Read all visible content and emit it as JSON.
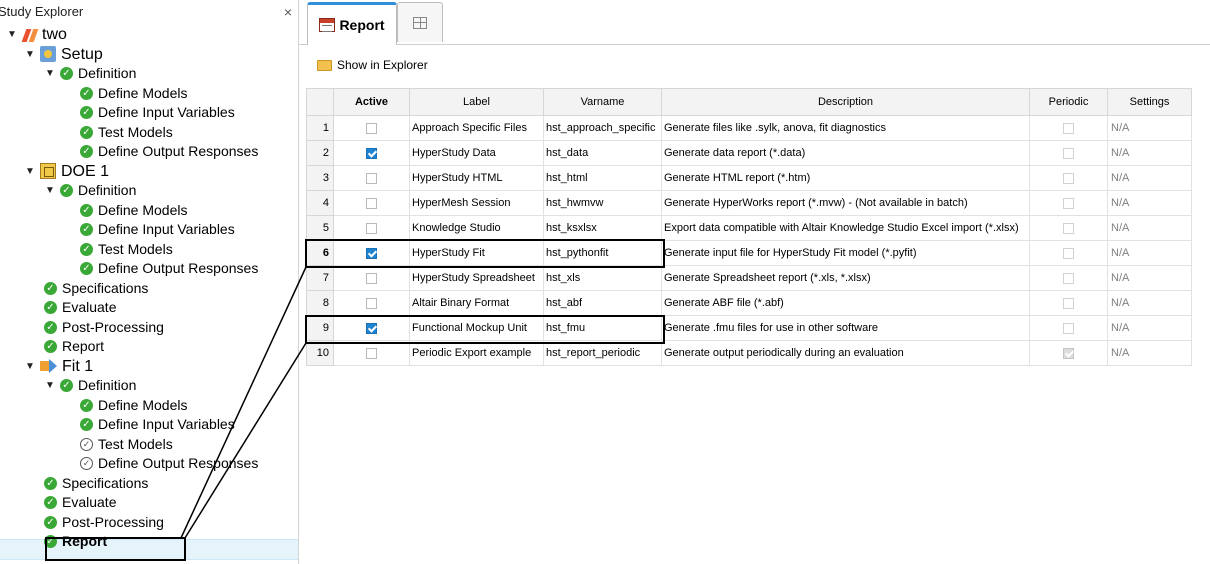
{
  "explorer": {
    "title": "Study Explorer",
    "close": "×",
    "tree": [
      {
        "label": "two",
        "icon": "study-icon",
        "level": 0,
        "kind": "top"
      },
      {
        "label": "Setup",
        "icon": "setup-icon",
        "level": 1,
        "kind": "top"
      },
      {
        "label": "Definition",
        "icon": "check-icon",
        "level": 2
      },
      {
        "label": "Define Models",
        "icon": "check-icon",
        "level": 3
      },
      {
        "label": "Define Input Variables",
        "icon": "check-icon",
        "level": 3
      },
      {
        "label": "Test Models",
        "icon": "check-icon",
        "level": 3
      },
      {
        "label": "Define Output Responses",
        "icon": "check-icon",
        "level": 3
      },
      {
        "label": "DOE 1",
        "icon": "doe-icon",
        "level": 1,
        "kind": "top"
      },
      {
        "label": "Definition",
        "icon": "check-icon",
        "level": 2
      },
      {
        "label": "Define Models",
        "icon": "check-icon",
        "level": 3
      },
      {
        "label": "Define Input Variables",
        "icon": "check-icon",
        "level": 3
      },
      {
        "label": "Test Models",
        "icon": "check-icon",
        "level": 3
      },
      {
        "label": "Define Output Responses",
        "icon": "check-icon",
        "level": 3
      },
      {
        "label": "Specifications",
        "icon": "check-icon",
        "level": 2
      },
      {
        "label": "Evaluate",
        "icon": "check-icon",
        "level": 2
      },
      {
        "label": "Post-Processing",
        "icon": "check-icon",
        "level": 2
      },
      {
        "label": "Report",
        "icon": "check-icon",
        "level": 2
      },
      {
        "label": "Fit 1",
        "icon": "fit-icon",
        "level": 1,
        "kind": "top"
      },
      {
        "label": "Definition",
        "icon": "check-icon",
        "level": 2
      },
      {
        "label": "Define Models",
        "icon": "check-icon",
        "level": 3
      },
      {
        "label": "Define Input Variables",
        "icon": "check-icon",
        "level": 3
      },
      {
        "label": "Test Models",
        "icon": "pending-check-icon",
        "level": 3
      },
      {
        "label": "Define Output Responses",
        "icon": "pending-check-icon",
        "level": 3
      },
      {
        "label": "Specifications",
        "icon": "check-icon",
        "level": 2
      },
      {
        "label": "Evaluate",
        "icon": "check-icon",
        "level": 2
      },
      {
        "label": "Post-Processing",
        "icon": "check-icon",
        "level": 2
      },
      {
        "label": "Report",
        "icon": "check-icon",
        "level": 2,
        "selected": true
      }
    ]
  },
  "tabs": [
    {
      "label": "Report",
      "icon": "report-icon",
      "active": true
    },
    {
      "label": "",
      "icon": "grid-icon",
      "active": false
    }
  ],
  "toolbar": {
    "show_in_explorer": "Show in Explorer",
    "icon": "folder-icon"
  },
  "table": {
    "columns": [
      "",
      "Active",
      "Label",
      "Varname",
      "Description",
      "Periodic",
      "Settings"
    ],
    "rows": [
      {
        "n": "1",
        "active": false,
        "label": "Approach Specific Files",
        "varname": "hst_approach_specific",
        "description": "Generate files like .sylk, anova, fit diagnostics",
        "periodic": false,
        "settings": "N/A"
      },
      {
        "n": "2",
        "active": true,
        "label": "HyperStudy Data",
        "varname": "hst_data",
        "description": "Generate data report (*.data)",
        "periodic": false,
        "settings": "N/A"
      },
      {
        "n": "3",
        "active": false,
        "label": "HyperStudy HTML",
        "varname": "hst_html",
        "description": "Generate HTML report (*.htm)",
        "periodic": false,
        "settings": "N/A"
      },
      {
        "n": "4",
        "active": false,
        "label": "HyperMesh Session",
        "varname": "hst_hwmvw",
        "description": "Generate HyperWorks report (*.mvw) - (Not available in batch)",
        "periodic": false,
        "settings": "N/A"
      },
      {
        "n": "5",
        "active": false,
        "label": "Knowledge Studio",
        "varname": "hst_ksxlsx",
        "description": "Export data compatible with Altair Knowledge Studio Excel import (*.xlsx)",
        "periodic": false,
        "settings": "N/A"
      },
      {
        "n": "6",
        "active": true,
        "label": "HyperStudy Fit",
        "varname": "hst_pythonfit",
        "description": "Generate input file for HyperStudy Fit model (*.pyfit)",
        "periodic": false,
        "settings": "N/A",
        "bold": true
      },
      {
        "n": "7",
        "active": false,
        "label": "HyperStudy Spreadsheet",
        "varname": "hst_xls",
        "description": "Generate Spreadsheet report (*.xls, *.xlsx)",
        "periodic": false,
        "settings": "N/A"
      },
      {
        "n": "8",
        "active": false,
        "label": "Altair Binary Format",
        "varname": "hst_abf",
        "description": "Generate ABF file (*.abf)",
        "periodic": false,
        "settings": "N/A"
      },
      {
        "n": "9",
        "active": true,
        "label": "Functional Mockup Unit",
        "varname": "hst_fmu",
        "description": "Generate .fmu files for use in other software",
        "periodic": false,
        "settings": "N/A"
      },
      {
        "n": "10",
        "active": false,
        "label": "Periodic Export example",
        "varname": "hst_report_periodic",
        "description": "Generate output periodically during an evaluation",
        "periodic": true,
        "settings": "N/A"
      }
    ]
  },
  "colors": {
    "accent": "#1e84d2",
    "ok": "#3aa836",
    "selection": "#e5f3fb"
  }
}
